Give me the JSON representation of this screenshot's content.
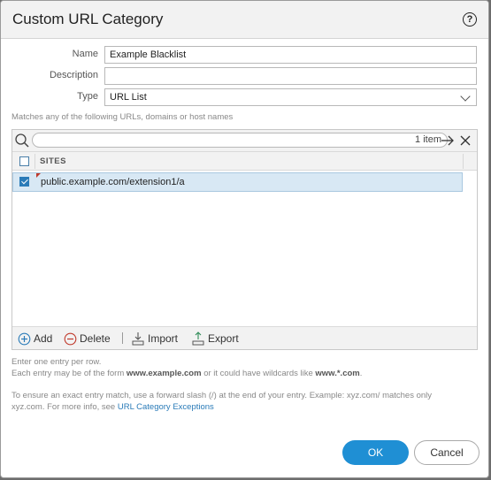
{
  "dialog": {
    "title": "Custom URL Category",
    "help_icon": "help-icon"
  },
  "form": {
    "name_label": "Name",
    "name_value": "Example Blacklist",
    "description_label": "Description",
    "description_value": "",
    "type_label": "Type",
    "type_value": "URL List"
  },
  "hint": "Matches any of the following URLs, domains or host names",
  "grid": {
    "search_value": "",
    "item_count": "1 item",
    "column_header": "SITES",
    "rows": [
      {
        "site": "public.example.com/extension1/a",
        "checked": true
      }
    ],
    "footer": {
      "add": "Add",
      "delete": "Delete",
      "import": "Import",
      "export": "Export"
    }
  },
  "info": {
    "line1": "Enter one entry per row.",
    "line2_pre": "Each entry may be of the form ",
    "line2_bold1": "www.example.com",
    "line2_mid": " or it could have wildcards like ",
    "line2_bold2": "www.*.com",
    "line2_post": ".",
    "line3": "To ensure an exact entry match, use a forward slash (/) at the end of your entry. Example: xyz.com/ matches only",
    "line4_pre": "xyz.com. For more info, see ",
    "line4_link": "URL Category Exceptions"
  },
  "buttons": {
    "ok": "OK",
    "cancel": "Cancel"
  },
  "colors": {
    "accent": "#1f8fd4",
    "selected_row": "#d8e8f4",
    "checkbox": "#2a7bb8",
    "link": "#2a7bb8",
    "add_icon": "#2a7bb8",
    "delete_icon": "#c0392b"
  }
}
